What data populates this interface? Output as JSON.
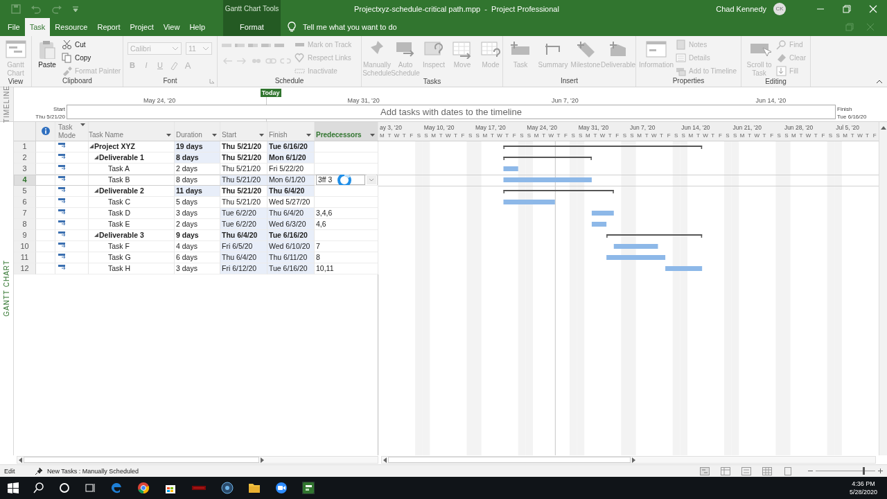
{
  "title_bar": {
    "context_label": "Gantt Chart Tools",
    "title": "Projectxyz-schedule-critical path.mpp  -  Project Professional",
    "user": "Chad Kennedy",
    "avatar": "CK"
  },
  "tabs": [
    {
      "label": "File",
      "selected": false,
      "kind": "normal"
    },
    {
      "label": "Task",
      "selected": true,
      "kind": "normal"
    },
    {
      "label": "Resource",
      "selected": false,
      "kind": "normal"
    },
    {
      "label": "Report",
      "selected": false,
      "kind": "normal"
    },
    {
      "label": "Project",
      "selected": false,
      "kind": "normal"
    },
    {
      "label": "View",
      "selected": false,
      "kind": "normal"
    },
    {
      "label": "Help",
      "selected": false,
      "kind": "normal"
    },
    {
      "label": "Format",
      "selected": false,
      "kind": "context"
    }
  ],
  "tell_me": {
    "placeholder": "Tell me what you want to do"
  },
  "ribbon": [
    {
      "label": "View",
      "items": [
        {
          "kind": "large",
          "label": "Gantt Chart",
          "disabled": true
        }
      ]
    },
    {
      "label": "Clipboard",
      "items": [
        {
          "kind": "large",
          "label": "Paste",
          "disabled": false
        },
        {
          "kind": "small",
          "label": "Cut",
          "disabled": false
        },
        {
          "kind": "small",
          "label": "Copy",
          "disabled": false
        },
        {
          "kind": "small",
          "label": "Format Painter",
          "disabled": true
        }
      ]
    },
    {
      "label": "Font",
      "items": [
        {
          "kind": "combo",
          "label": "Calibri",
          "disabled": true
        },
        {
          "kind": "combo",
          "label": "11",
          "disabled": true
        },
        {
          "kind": "glyph",
          "label": "B",
          "disabled": true
        },
        {
          "kind": "glyph",
          "label": "I",
          "disabled": true
        },
        {
          "kind": "glyph",
          "label": "U",
          "disabled": true
        },
        {
          "kind": "glyph",
          "label": "A",
          "disabled": true
        }
      ]
    },
    {
      "label": "Schedule",
      "items": [
        {
          "kind": "icons",
          "disabled": true
        },
        {
          "kind": "small",
          "label": "Mark on Track",
          "disabled": true
        },
        {
          "kind": "small",
          "label": "Respect Links",
          "disabled": true
        },
        {
          "kind": "small",
          "label": "Inactivate",
          "disabled": true
        }
      ]
    },
    {
      "label": "Tasks",
      "items": [
        {
          "kind": "large",
          "label": "Manually Schedule",
          "disabled": true
        },
        {
          "kind": "large",
          "label": "Auto Schedule",
          "disabled": true
        },
        {
          "kind": "large",
          "label": "Inspect",
          "disabled": true
        },
        {
          "kind": "large",
          "label": "Move",
          "disabled": true
        },
        {
          "kind": "large",
          "label": "Mode",
          "disabled": true
        }
      ]
    },
    {
      "label": "Insert",
      "items": [
        {
          "kind": "large",
          "label": "Task",
          "disabled": true
        },
        {
          "kind": "large",
          "label": "Summary",
          "disabled": true
        },
        {
          "kind": "large",
          "label": "Milestone",
          "disabled": true
        },
        {
          "kind": "large",
          "label": "Deliverable",
          "disabled": true
        }
      ]
    },
    {
      "label": "Properties",
      "items": [
        {
          "kind": "large",
          "label": "Information",
          "disabled": true
        },
        {
          "kind": "small",
          "label": "Notes",
          "disabled": true
        },
        {
          "kind": "small",
          "label": "Details",
          "disabled": true
        },
        {
          "kind": "small",
          "label": "Add to Timeline",
          "disabled": true
        }
      ]
    },
    {
      "label": "Editing",
      "items": [
        {
          "kind": "large",
          "label": "Scroll to Task",
          "disabled": true
        },
        {
          "kind": "small",
          "label": "Find",
          "disabled": true
        },
        {
          "kind": "small",
          "label": "Clear",
          "disabled": true
        },
        {
          "kind": "small",
          "label": "Fill",
          "disabled": true
        }
      ]
    }
  ],
  "timeline": {
    "side_label": "TIMELINE",
    "today": "Today",
    "dates": [
      "May 24, '20",
      "May 31, '20",
      "Jun 7, '20",
      "Jun 14, '20"
    ],
    "start_label": "Start",
    "start": "Thu 5/21/20",
    "finish_label": "Finish",
    "finish": "Tue 6/16/20",
    "placeholder": "Add tasks with dates to the timeline"
  },
  "view_label": "GANTT CHART",
  "table": {
    "columns": [
      {
        "label": "Task Mode",
        "kind": "mode",
        "selected": false
      },
      {
        "label": "Task Name",
        "kind": "name",
        "selected": false
      },
      {
        "label": "Duration",
        "kind": "duration",
        "selected": false
      },
      {
        "label": "Start",
        "kind": "start",
        "selected": false
      },
      {
        "label": "Finish",
        "kind": "finish",
        "selected": false
      },
      {
        "label": "Predecessors",
        "kind": "pred",
        "selected": true
      }
    ],
    "rows": [
      {
        "id": "1",
        "name": "Project XYZ",
        "expanded": true,
        "selected": false,
        "duration": {
          "text": "19 days",
          "changed": true
        },
        "start": {
          "text": "Thu 5/21/20",
          "changed": false
        },
        "finish": {
          "text": "Tue 6/16/20",
          "changed": true
        },
        "children": [
          {
            "id": "2",
            "name": "Deliverable 1",
            "expanded": true,
            "selected": false,
            "duration": {
              "text": "8 days",
              "changed": true
            },
            "start": {
              "text": "Thu 5/21/20",
              "changed": false
            },
            "finish": {
              "text": "Mon 6/1/20",
              "changed": true
            },
            "children": [
              {
                "id": "3",
                "name": "Task A",
                "selected": false,
                "duration": {
                  "text": "2 days",
                  "changed": false
                },
                "start": {
                  "text": "Thu 5/21/20",
                  "changed": false
                },
                "finish": {
                  "text": "Fri 5/22/20",
                  "changed": false
                }
              },
              {
                "id": "4",
                "name": "Task B",
                "selected": true,
                "duration": {
                  "text": "8 days",
                  "changed": false
                },
                "start": {
                  "text": "Thu 5/21/20",
                  "changed": true
                },
                "finish": {
                  "text": "Mon 6/1/20",
                  "changed": true
                },
                "predecessors": "3ff 3"
              }
            ]
          },
          {
            "id": "5",
            "name": "Deliverable 2",
            "expanded": true,
            "selected": false,
            "duration": {
              "text": "11 days",
              "changed": true
            },
            "start": {
              "text": "Thu 5/21/20",
              "changed": false
            },
            "finish": {
              "text": "Thu 6/4/20",
              "changed": true
            },
            "children": [
              {
                "id": "6",
                "name": "Task C",
                "selected": false,
                "duration": {
                  "text": "5 days",
                  "changed": false
                },
                "start": {
                  "text": "Thu 5/21/20",
                  "changed": false
                },
                "finish": {
                  "text": "Wed 5/27/20",
                  "changed": false
                }
              },
              {
                "id": "7",
                "name": "Task D",
                "selected": false,
                "duration": {
                  "text": "3 days",
                  "changed": false
                },
                "start": {
                  "text": "Tue 6/2/20",
                  "changed": true
                },
                "finish": {
                  "text": "Thu 6/4/20",
                  "changed": true
                },
                "predecessors": "3,4,6"
              },
              {
                "id": "8",
                "name": "Task E",
                "selected": false,
                "duration": {
                  "text": "2 days",
                  "changed": false
                },
                "start": {
                  "text": "Tue 6/2/20",
                  "changed": true
                },
                "finish": {
                  "text": "Wed 6/3/20",
                  "changed": true
                },
                "predecessors": "4,6"
              }
            ]
          },
          {
            "id": "9",
            "name": "Deliverable 3",
            "expanded": true,
            "selected": false,
            "duration": {
              "text": "9 days",
              "changed": false
            },
            "start": {
              "text": "Thu 6/4/20",
              "changed": true
            },
            "finish": {
              "text": "Tue 6/16/20",
              "changed": true
            },
            "children": [
              {
                "id": "10",
                "name": "Task F",
                "selected": false,
                "duration": {
                  "text": "4 days",
                  "changed": false
                },
                "start": {
                  "text": "Fri 6/5/20",
                  "changed": true
                },
                "finish": {
                  "text": "Wed 6/10/20",
                  "changed": true
                },
                "predecessors": "7"
              },
              {
                "id": "11",
                "name": "Task G",
                "selected": false,
                "duration": {
                  "text": "6 days",
                  "changed": false
                },
                "start": {
                  "text": "Thu 6/4/20",
                  "changed": true
                },
                "finish": {
                  "text": "Thu 6/11/20",
                  "changed": true
                },
                "predecessors": "8"
              },
              {
                "id": "12",
                "name": "Task H",
                "selected": false,
                "duration": {
                  "text": "3 days",
                  "changed": false
                },
                "start": {
                  "text": "Fri 6/12/20",
                  "changed": true
                },
                "finish": {
                  "text": "Tue 6/16/20",
                  "changed": true
                },
                "predecessors": "10,11"
              }
            ]
          }
        ]
      }
    ]
  },
  "timescale": [
    {
      "label": "ay 3, '20",
      "days": "M T W T F S"
    },
    {
      "label": "May 10, '20",
      "days": "S M T W T F S"
    },
    {
      "label": "May 17, '20",
      "days": "S M T W T F S"
    },
    {
      "label": "May 24, '20",
      "days": "S M T W T F S"
    },
    {
      "label": "May 31, '20",
      "days": "S M T W T F S"
    },
    {
      "label": "Jun 7, '20",
      "days": "S M T W T F S"
    },
    {
      "label": "Jun 14, '20",
      "days": "S M T W T F S"
    },
    {
      "label": "Jun 21, '20",
      "days": "S M T W T F S"
    },
    {
      "label": "Jun 28, '20",
      "days": "S M T W T F S"
    },
    {
      "label": "Jul 5, '20",
      "days": "S M T W T F"
    }
  ],
  "status_bar": {
    "mode": "Edit",
    "new_tasks": "New Tasks : Manually Scheduled",
    "zoom": {
      "level": 0.8
    }
  },
  "taskbar": {
    "time": "4:36 PM",
    "date": "5/28/2020"
  }
}
